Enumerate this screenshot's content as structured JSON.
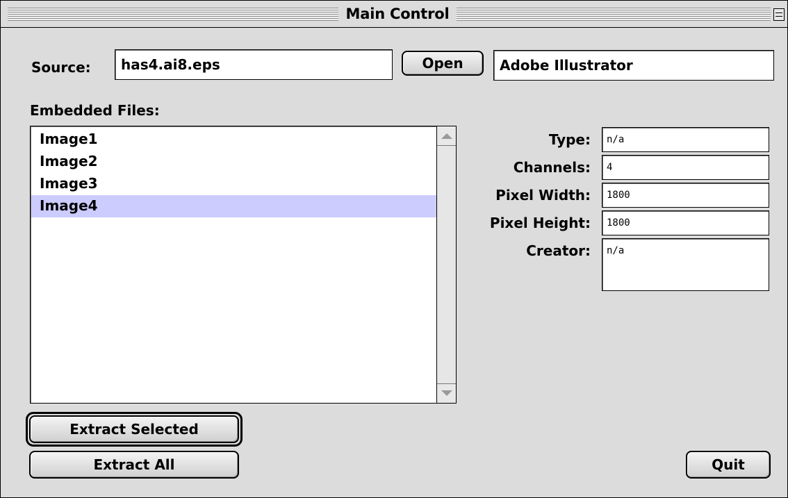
{
  "window": {
    "title": "Main Control"
  },
  "source": {
    "label": "Source:",
    "value": "has4.ai8.eps",
    "open_label": "Open",
    "format": "Adobe Illustrator"
  },
  "embedded": {
    "label": "Embedded Files:",
    "items": [
      "Image1",
      "Image2",
      "Image3",
      "Image4"
    ],
    "selected": "Image4"
  },
  "details": {
    "type_label": "Type:",
    "type_value": "n/a",
    "channels_label": "Channels:",
    "channels_value": "4",
    "width_label": "Pixel Width:",
    "width_value": "1800",
    "height_label": "Pixel Height:",
    "height_value": "1800",
    "creator_label": "Creator:",
    "creator_value": "n/a"
  },
  "buttons": {
    "extract_selected": "Extract Selected",
    "extract_all": "Extract All",
    "quit": "Quit"
  },
  "colors": {
    "selection": "#ccccff",
    "window_bg": "#dcdcdc"
  },
  "icons": {
    "collapse": "window-collapse-box-icon",
    "scroll_up": "scroll-up-arrow-icon",
    "scroll_down": "scroll-down-arrow-icon"
  }
}
